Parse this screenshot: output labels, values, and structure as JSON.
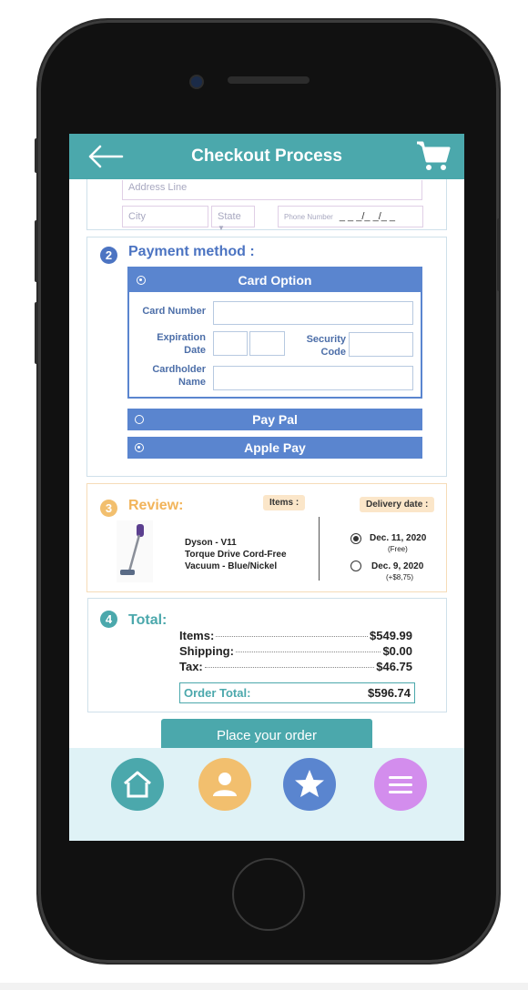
{
  "header": {
    "title": "Checkout Process"
  },
  "address": {
    "address_line_placeholder": "Address Line",
    "city_placeholder": "City",
    "state_placeholder": "State",
    "phone_label": "Phone Number",
    "phone_mask": "_ _ _/_ _/_ _"
  },
  "payment": {
    "number": "2",
    "title": "Payment method :",
    "card_option": {
      "label": "Card Option",
      "card_number_label": "Card Number",
      "expiration_label_1": "Expiration",
      "expiration_label_2": "Date",
      "security_label_1": "Security",
      "security_label_2": "Code",
      "holder_label_1": "Cardholder",
      "holder_label_2": "Name"
    },
    "paypal_label": "Pay Pal",
    "applepay_label": "Apple Pay"
  },
  "review": {
    "number": "3",
    "title": "Review:",
    "items_tag": "Items :",
    "delivery_tag": "Delivery date :",
    "product_line1": "Dyson - V11",
    "product_line2": "Torque Drive Cord-Free",
    "product_line3": "Vacuum - Blue/Nickel",
    "delivery_options": [
      {
        "date": "Dec. 11, 2020",
        "note": "(Free)",
        "selected": true
      },
      {
        "date": "Dec. 9, 2020",
        "note": "(+$8,75)",
        "selected": false
      }
    ]
  },
  "total": {
    "number": "4",
    "title": "Total:",
    "rows": [
      {
        "label": "Items:",
        "value": "$549.99"
      },
      {
        "label": "Shipping:",
        "value": "$0.00"
      },
      {
        "label": "Tax:",
        "value": "$46.75"
      }
    ],
    "order_total_label": "Order Total:",
    "order_total_value": "$596.74"
  },
  "place_order_label": "Place your order",
  "tabbar": [
    {
      "icon": "home-icon",
      "color": "#4ba8ac"
    },
    {
      "icon": "user-icon",
      "color": "#f2bf6e"
    },
    {
      "icon": "star-icon",
      "color": "#5a85cf"
    },
    {
      "icon": "menu-icon",
      "color": "#d38ded"
    }
  ],
  "colors": {
    "teal": "#4ba8ac",
    "blue": "#5a85cf",
    "orange": "#f2bf6e",
    "purple": "#d38ded"
  }
}
